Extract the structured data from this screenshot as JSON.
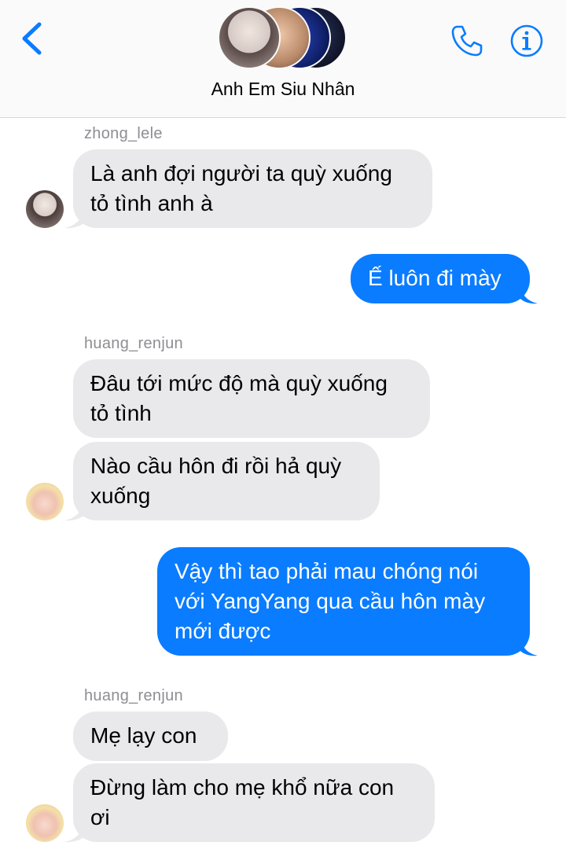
{
  "header": {
    "title": "Anh Em Siu Nhân",
    "icons": [
      "chevron-left-icon",
      "phone-icon",
      "info-icon"
    ],
    "accent": "#0a7cff"
  },
  "messages": [
    {
      "sender": "zhong_lele",
      "lines": [
        "Là anh đợi người ta quỳ xuống",
        "tỏ tình anh à"
      ]
    },
    {
      "sender": "me",
      "lines": [
        "Ế luôn đi mày"
      ]
    },
    {
      "sender": "huang_renjun",
      "lines": [
        "Đâu tới mức độ mà quỳ xuống",
        "tỏ tình"
      ]
    },
    {
      "sender": "huang_renjun",
      "lines": [
        "Nào cầu hôn đi rồi hả quỳ",
        "xuống"
      ]
    },
    {
      "sender": "me",
      "lines": [
        "Vậy thì tao phải mau chóng nói",
        "với YangYang qua cầu hôn mày",
        "mới được"
      ]
    },
    {
      "sender": "huang_renjun",
      "lines": [
        "Mẹ lạy con"
      ]
    },
    {
      "sender": "huang_renjun",
      "lines": [
        "Đừng làm cho mẹ khổ nữa con",
        "ơi"
      ]
    }
  ],
  "colors": {
    "incoming_bubble": "#e9e9eb",
    "outgoing_bubble": "#0a7cff",
    "sender_name": "#8e8e93"
  }
}
